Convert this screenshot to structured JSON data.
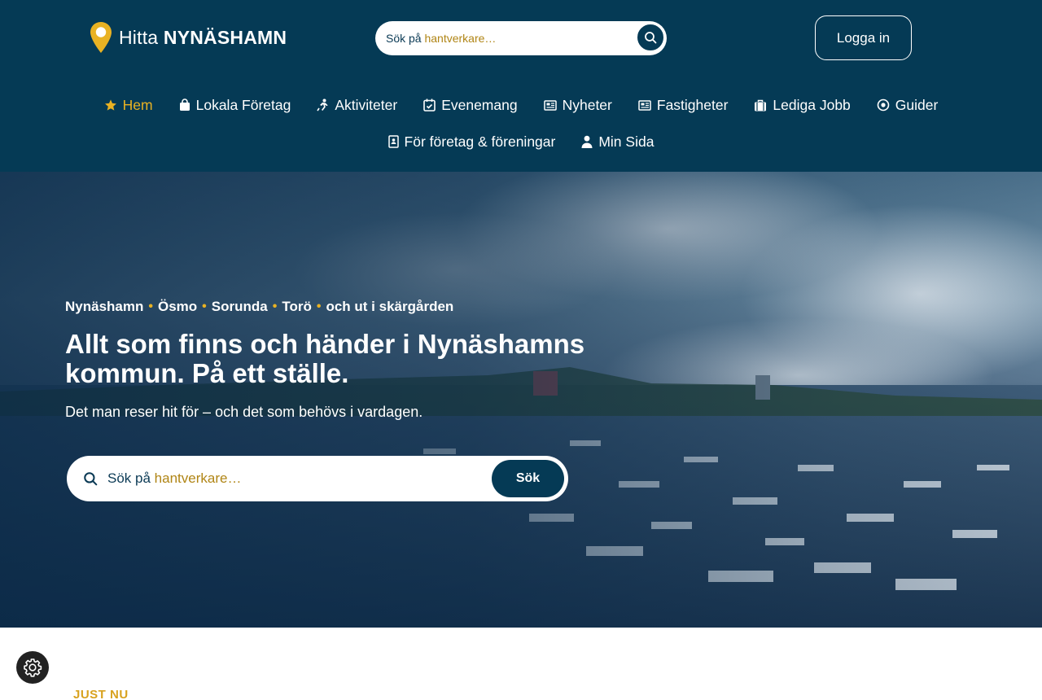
{
  "brand": {
    "prefix": "Hitta",
    "name": "NYNÄSHAMN",
    "accent": "#e9b223",
    "primary": "#053a55"
  },
  "top_search": {
    "prefix": "Sök på",
    "highlight": "hantverkare…",
    "button_icon": "search-icon"
  },
  "login_label": "Logga in",
  "nav": {
    "row1": [
      {
        "label": "Hem",
        "icon": "star-icon",
        "active": true
      },
      {
        "label": "Lokala Företag",
        "icon": "shopping-bag-icon"
      },
      {
        "label": "Aktiviteter",
        "icon": "running-icon"
      },
      {
        "label": "Evenemang",
        "icon": "calendar-check-icon"
      },
      {
        "label": "Nyheter",
        "icon": "newspaper-icon"
      },
      {
        "label": "Fastigheter",
        "icon": "newspaper-icon"
      },
      {
        "label": "Lediga Jobb",
        "icon": "suitcase-icon"
      },
      {
        "label": "Guider",
        "icon": "circle-dot-icon"
      }
    ],
    "row2": [
      {
        "label": "För företag & föreningar",
        "icon": "id-badge-icon"
      },
      {
        "label": "Min Sida",
        "icon": "user-icon"
      }
    ]
  },
  "hero": {
    "places": [
      "Nynäshamn",
      "Ösmo",
      "Sorunda",
      "Torö",
      "och ut i skärgården"
    ],
    "separator": "•",
    "title": "Allt som finns och händer i Nynäshamns kommun. På ett ställe.",
    "subtitle": "Det man reser hit för – och det som behövs i vardagen.",
    "search": {
      "prefix": "Sök på",
      "highlight": "hantverkare…",
      "button": "Sök"
    }
  },
  "section_label": "JUST NU",
  "cookie_settings_icon": "gear-icon"
}
